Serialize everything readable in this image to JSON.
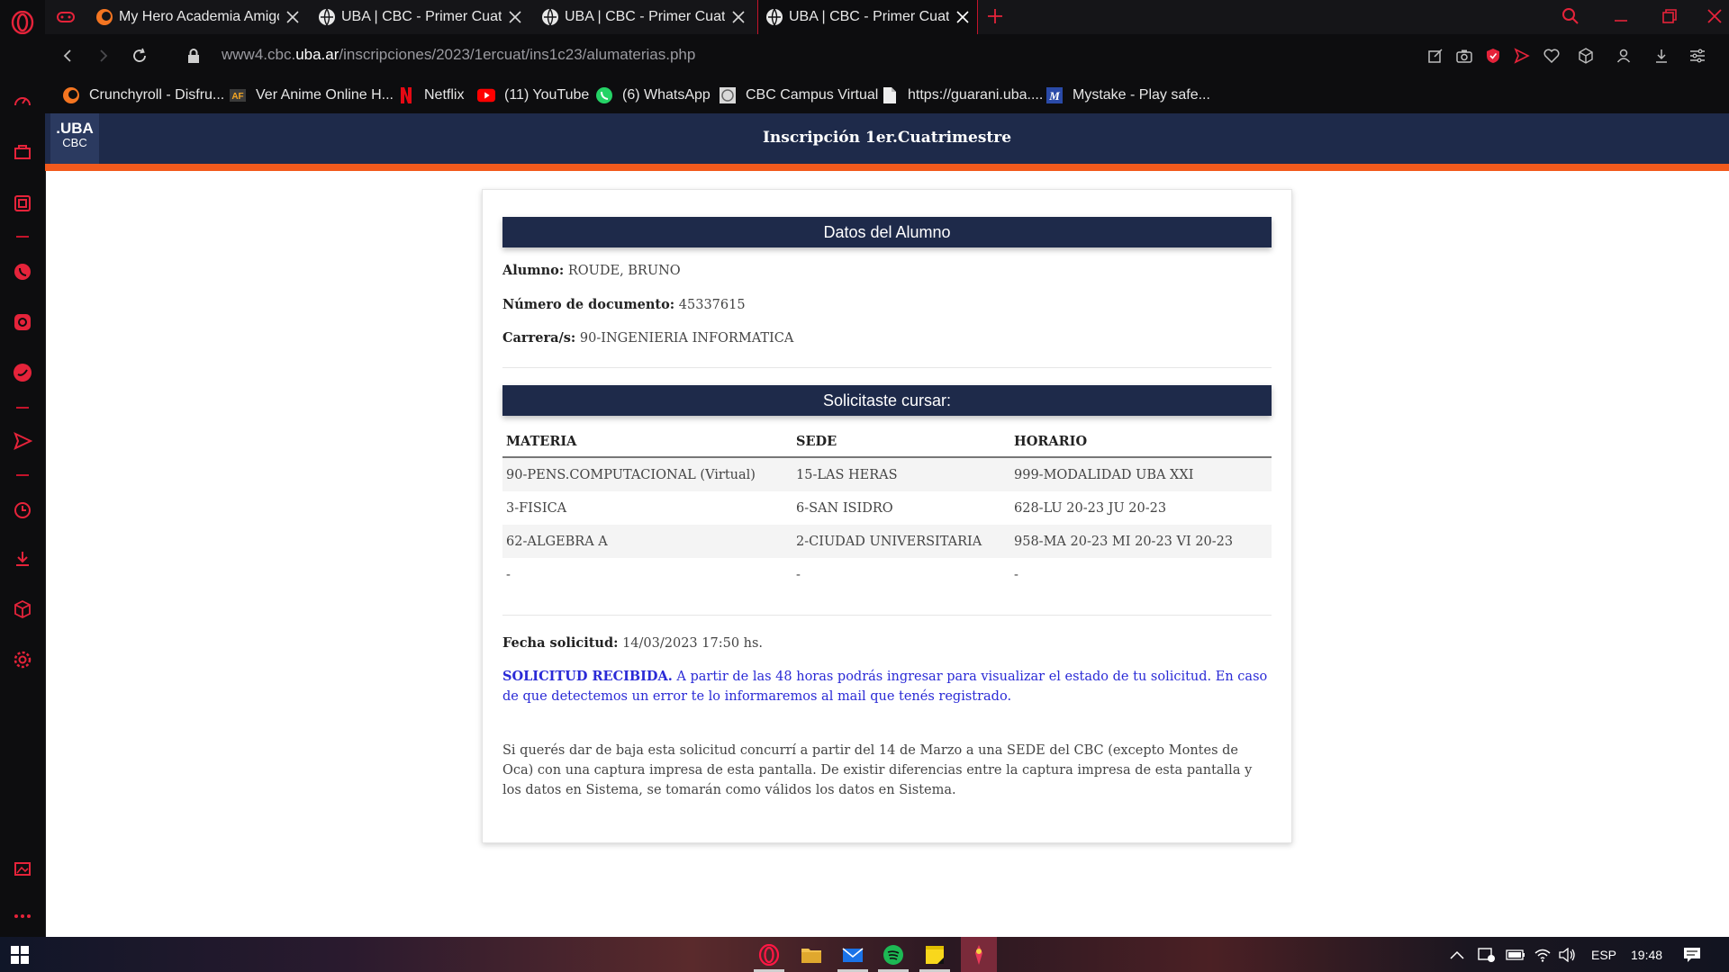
{
  "browser": {
    "tabs": [
      {
        "title": "My Hero Academia Amigos",
        "favicon": "crunchyroll-icon",
        "active": false
      },
      {
        "title": "UBA | CBC - Primer Cuatrimestre",
        "favicon": "globe-icon",
        "active": false
      },
      {
        "title": "UBA | CBC - Primer Cuatrimestre",
        "favicon": "globe-icon",
        "active": false
      },
      {
        "title": "UBA | CBC - Primer Cuatrimestre",
        "favicon": "globe-icon",
        "active": true
      }
    ],
    "url_prefix": "www4.cbc.",
    "url_domain": "uba.ar",
    "url_path": "/inscripciones/2023/1ercuat/ins1c23/alumaterias.php",
    "bookmarks": [
      {
        "label": "Crunchyroll - Disfru...",
        "icon": "crunchyroll-icon"
      },
      {
        "label": "Ver Anime Online H...",
        "icon": "animeflv-icon"
      },
      {
        "label": "Netflix",
        "icon": "netflix-icon"
      },
      {
        "label": "(11) YouTube",
        "icon": "youtube-icon"
      },
      {
        "label": "(6) WhatsApp",
        "icon": "whatsapp-icon"
      },
      {
        "label": "CBC Campus Virtual",
        "icon": "cbc-campus-icon"
      },
      {
        "label": "https://guarani.uba....",
        "icon": "page-icon"
      },
      {
        "label": "Mystake - Play safe...",
        "icon": "mystake-icon"
      }
    ],
    "accent": "#c4132a"
  },
  "site": {
    "logo_line1": ".UBA",
    "logo_line2": "CBC",
    "header_title": "Inscripción 1er.Cuatrimestre",
    "header_color": "#1e2a4a",
    "strip_color": "#f25a1d"
  },
  "student": {
    "section_title": "Datos del Alumno",
    "name_label": "Alumno:",
    "name": "ROUDE, BRUNO",
    "doc_label": "Número de documento:",
    "doc": "45337615",
    "career_label": "Carrera/s:",
    "career": "90-INGENIERIA INFORMATICA"
  },
  "courses": {
    "section_title": "Solicitaste cursar:",
    "headers": [
      "MATERIA",
      "SEDE",
      "HORARIO"
    ],
    "rows": [
      [
        "90-PENS.COMPUTACIONAL (Virtual)",
        "15-LAS HERAS",
        "999-MODALIDAD UBA XXI"
      ],
      [
        "3-FISICA",
        "6-SAN ISIDRO",
        "628-LU 20-23 JU 20-23"
      ],
      [
        "62-ALGEBRA A",
        "2-CIUDAD UNIVERSITARIA",
        "958-MA 20-23 MI 20-23 VI 20-23"
      ],
      [
        "-",
        "-",
        "-"
      ]
    ]
  },
  "request": {
    "date_label": "Fecha solicitud:",
    "date": "14/03/2023 17:50 hs.",
    "status_strong": "SOLICITUD RECIBIDA.",
    "status_text": " A partir de las 48 horas podrás ingresar para visualizar el estado de tu solicitud. En caso de que detectemos un error te lo informaremos al mail que tenés registrado.",
    "notice": "Si querés dar de baja esta solicitud concurrí a partir del 14 de Marzo a una SEDE del CBC (excepto Montes de Oca) con una captura impresa de esta pantalla. De existir diferencias entre la captura impresa de esta pantalla y los datos en Sistema, se tomarán como válidos los datos en Sistema."
  },
  "taskbar": {
    "language": "ESP",
    "time": "19:48"
  }
}
